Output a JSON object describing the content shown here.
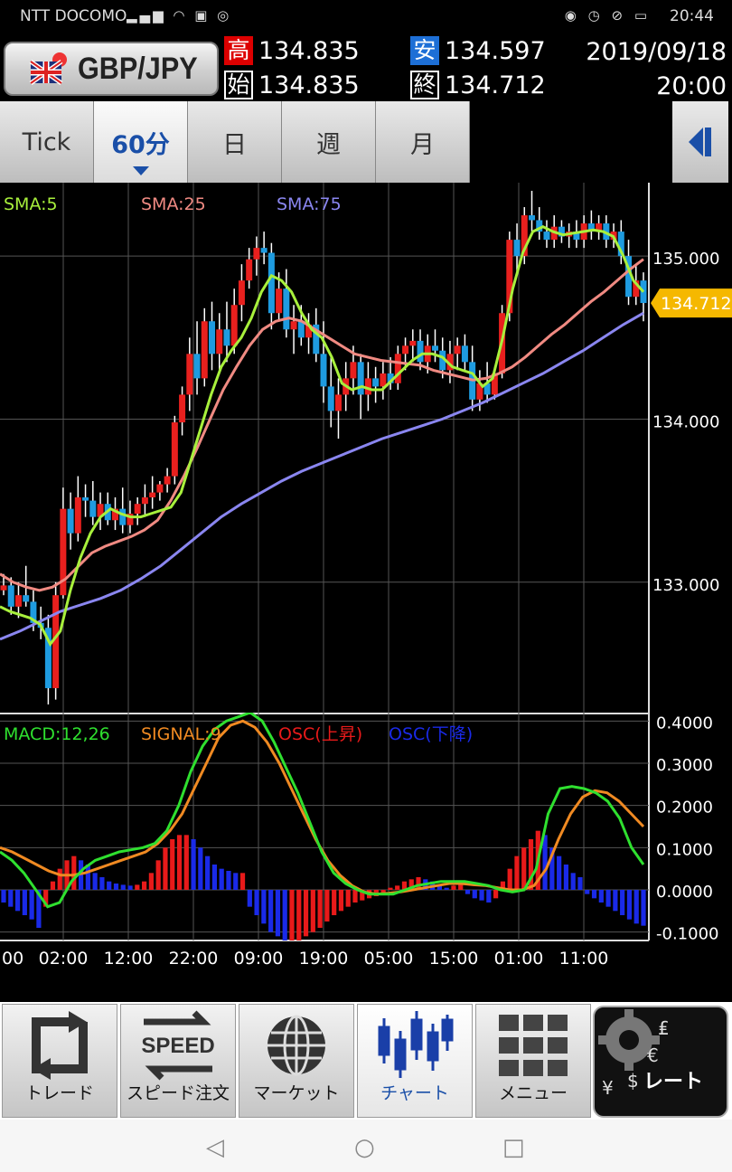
{
  "status_bar": {
    "carrier": "NTT DOCOMO",
    "time": "20:44"
  },
  "header": {
    "pair": "GBP/JPY",
    "high_label": "高",
    "high": "134.835",
    "low_label": "安",
    "low": "134.597",
    "open_label": "始",
    "open": "134.835",
    "close_label": "終",
    "close": "134.712",
    "date": "2019/09/18",
    "time": "20:00"
  },
  "tabs": [
    {
      "label": "Tick",
      "active": false
    },
    {
      "label": "60分",
      "active": true
    },
    {
      "label": "日",
      "active": false
    },
    {
      "label": "週",
      "active": false
    },
    {
      "label": "月",
      "active": false
    }
  ],
  "chart_data": [
    {
      "type": "candlestick",
      "legend": [
        "SMA:5",
        "SMA:25",
        "SMA:75"
      ],
      "colors": {
        "sma5": "#a8f03c",
        "sma25": "#f08a82",
        "sma75": "#8a86f0",
        "up": "#e8201e",
        "down": "#1e9be0",
        "wick": "#ffffff",
        "grid": "#555555",
        "price_tag": "#f5b800"
      },
      "ylim": [
        132.2,
        135.45
      ],
      "y_ticks": [
        "135.000",
        "134.000",
        "133.000"
      ],
      "current_price": "134.712",
      "candles": [
        [
          132.95,
          133.05,
          132.92,
          132.98
        ],
        [
          132.98,
          133.03,
          132.8,
          132.85
        ],
        [
          132.85,
          133.0,
          132.78,
          132.92
        ],
        [
          132.92,
          133.1,
          132.85,
          132.88
        ],
        [
          132.88,
          132.95,
          132.7,
          132.75
        ],
        [
          132.75,
          132.85,
          132.65,
          132.72
        ],
        [
          132.72,
          132.8,
          132.25,
          132.35
        ],
        [
          132.35,
          133.0,
          132.28,
          132.92
        ],
        [
          132.92,
          133.58,
          132.9,
          133.45
        ],
        [
          133.45,
          133.55,
          133.2,
          133.3
        ],
        [
          133.3,
          133.65,
          133.25,
          133.52
        ],
        [
          133.52,
          133.6,
          133.4,
          133.5
        ],
        [
          133.5,
          133.62,
          133.35,
          133.4
        ],
        [
          133.4,
          133.55,
          133.32,
          133.48
        ],
        [
          133.48,
          133.55,
          133.35,
          133.38
        ],
        [
          133.38,
          133.52,
          133.32,
          133.45
        ],
        [
          133.45,
          133.58,
          133.3,
          133.35
        ],
        [
          133.35,
          133.5,
          133.3,
          133.42
        ],
        [
          133.42,
          133.52,
          133.35,
          133.48
        ],
        [
          133.48,
          133.6,
          133.4,
          133.52
        ],
        [
          133.52,
          133.65,
          133.45,
          133.55
        ],
        [
          133.55,
          133.62,
          133.5,
          133.6
        ],
        [
          133.6,
          133.7,
          133.55,
          133.65
        ],
        [
          133.65,
          134.02,
          133.6,
          133.98
        ],
        [
          133.98,
          134.2,
          133.9,
          134.15
        ],
        [
          134.15,
          134.5,
          134.05,
          134.4
        ],
        [
          134.4,
          134.6,
          134.15,
          134.25
        ],
        [
          134.25,
          134.68,
          134.2,
          134.6
        ],
        [
          134.6,
          134.72,
          134.3,
          134.4
        ],
        [
          134.4,
          134.65,
          134.3,
          134.55
        ],
        [
          134.55,
          134.72,
          134.35,
          134.45
        ],
        [
          134.45,
          134.8,
          134.4,
          134.7
        ],
        [
          134.7,
          134.95,
          134.6,
          134.85
        ],
        [
          134.85,
          135.05,
          134.8,
          134.98
        ],
        [
          134.98,
          135.12,
          134.88,
          135.05
        ],
        [
          135.05,
          135.15,
          134.95,
          135.02
        ],
        [
          135.02,
          135.08,
          134.55,
          134.65
        ],
        [
          134.65,
          134.9,
          134.6,
          134.8
        ],
        [
          134.8,
          134.92,
          134.5,
          134.55
        ],
        [
          134.55,
          134.7,
          134.4,
          134.6
        ],
        [
          134.6,
          134.7,
          134.45,
          134.5
        ],
        [
          134.5,
          134.65,
          134.4,
          134.58
        ],
        [
          134.58,
          134.68,
          134.35,
          134.4
        ],
        [
          134.4,
          134.6,
          134.1,
          134.2
        ],
        [
          134.2,
          134.4,
          133.95,
          134.05
        ],
        [
          134.05,
          134.25,
          133.88,
          134.15
        ],
        [
          134.15,
          134.35,
          134.05,
          134.25
        ],
        [
          134.25,
          134.45,
          134.15,
          134.35
        ],
        [
          134.35,
          134.4,
          134.0,
          134.15
        ],
        [
          134.15,
          134.35,
          134.05,
          134.25
        ],
        [
          134.25,
          134.32,
          134.1,
          134.2
        ],
        [
          134.2,
          134.35,
          134.12,
          134.28
        ],
        [
          134.28,
          134.38,
          134.18,
          134.22
        ],
        [
          134.22,
          134.45,
          134.18,
          134.4
        ],
        [
          134.4,
          134.5,
          134.3,
          134.45
        ],
        [
          134.45,
          134.55,
          134.35,
          134.48
        ],
        [
          134.48,
          134.55,
          134.3,
          134.35
        ],
        [
          134.35,
          134.52,
          134.28,
          134.45
        ],
        [
          134.45,
          134.55,
          134.35,
          134.42
        ],
        [
          134.42,
          134.5,
          134.25,
          134.3
        ],
        [
          134.3,
          134.48,
          134.22,
          134.4
        ],
        [
          134.4,
          134.5,
          134.3,
          134.45
        ],
        [
          134.45,
          134.52,
          134.3,
          134.35
        ],
        [
          134.35,
          134.45,
          134.05,
          134.12
        ],
        [
          134.12,
          134.3,
          134.05,
          134.22
        ],
        [
          134.22,
          134.35,
          134.1,
          134.15
        ],
        [
          134.15,
          134.32,
          134.12,
          134.28
        ],
        [
          134.28,
          134.7,
          134.25,
          134.65
        ],
        [
          134.65,
          135.15,
          134.6,
          135.1
        ],
        [
          135.1,
          135.2,
          134.9,
          135.0
        ],
        [
          135.0,
          135.3,
          134.95,
          135.25
        ],
        [
          135.25,
          135.4,
          135.15,
          135.22
        ],
        [
          135.22,
          135.3,
          135.1,
          135.15
        ],
        [
          135.15,
          135.22,
          135.05,
          135.1
        ],
        [
          135.1,
          135.25,
          135.05,
          135.18
        ],
        [
          135.18,
          135.22,
          135.08,
          135.12
        ],
        [
          135.12,
          135.2,
          135.05,
          135.15
        ],
        [
          135.15,
          135.22,
          135.05,
          135.1
        ],
        [
          135.1,
          135.25,
          135.05,
          135.2
        ],
        [
          135.2,
          135.28,
          135.1,
          135.15
        ],
        [
          135.15,
          135.25,
          135.1,
          135.2
        ],
        [
          135.2,
          135.25,
          135.05,
          135.1
        ],
        [
          135.1,
          135.2,
          135.05,
          135.15
        ],
        [
          135.15,
          135.22,
          134.95,
          135.0
        ],
        [
          135.0,
          135.1,
          134.7,
          134.75
        ],
        [
          134.75,
          134.95,
          134.7,
          134.85
        ],
        [
          134.85,
          134.9,
          134.6,
          134.712
        ]
      ],
      "sma5": [
        132.85,
        132.82,
        132.8,
        132.78,
        132.74,
        132.62,
        132.7,
        132.95,
        133.15,
        133.3,
        133.4,
        133.45,
        133.42,
        133.4,
        133.4,
        133.42,
        133.44,
        133.46,
        133.55,
        133.75,
        133.95,
        134.15,
        134.32,
        134.42,
        134.5,
        134.62,
        134.78,
        134.88,
        134.85,
        134.78,
        134.65,
        134.55,
        134.5,
        134.38,
        134.22,
        134.18,
        134.2,
        134.18,
        134.18,
        134.24,
        134.3,
        134.36,
        134.4,
        134.4,
        134.38,
        134.32,
        134.3,
        134.28,
        134.2,
        134.25,
        134.5,
        134.8,
        135.02,
        135.15,
        135.18,
        135.15,
        135.13,
        135.14,
        135.15,
        135.16,
        135.15,
        135.12,
        135.0,
        134.85,
        134.78
      ],
      "sma25": [
        133.05,
        133.0,
        132.97,
        132.95,
        132.97,
        133.02,
        133.1,
        133.18,
        133.22,
        133.25,
        133.28,
        133.32,
        133.38,
        133.5,
        133.65,
        133.82,
        134.0,
        134.18,
        134.32,
        134.45,
        134.55,
        134.6,
        134.62,
        134.6,
        134.55,
        134.5,
        134.45,
        134.4,
        134.38,
        134.36,
        134.35,
        134.34,
        134.33,
        134.3,
        134.28,
        134.26,
        134.24,
        134.25,
        134.28,
        134.32,
        134.38,
        134.45,
        134.52,
        134.58,
        134.65,
        134.72,
        134.78,
        134.85,
        134.92,
        134.98
      ],
      "sma75": [
        132.65,
        132.7,
        132.76,
        132.82,
        132.86,
        132.9,
        132.95,
        133.02,
        133.1,
        133.2,
        133.3,
        133.4,
        133.48,
        133.55,
        133.62,
        133.68,
        133.73,
        133.78,
        133.83,
        133.88,
        133.92,
        133.96,
        134.0,
        134.05,
        134.1,
        134.16,
        134.22,
        134.28,
        134.35,
        134.42,
        134.5,
        134.58,
        134.65
      ]
    },
    {
      "type": "macd",
      "legend": [
        "MACD:12,26",
        "SIGNAL:9",
        "OSC(上昇)",
        "OSC(下降)"
      ],
      "colors": {
        "macd": "#2fe02f",
        "signal": "#f08a22",
        "osc_up": "#e81a1a",
        "osc_down": "#1a2ae8",
        "grid": "#555555"
      },
      "ylim": [
        -0.12,
        0.42
      ],
      "y_ticks": [
        "0.4000",
        "0.3000",
        "0.2000",
        "0.1000",
        "0.0000",
        "-0.1000"
      ],
      "x_ticks": [
        "00",
        "02:00",
        "12:00",
        "22:00",
        "09:00",
        "19:00",
        "05:00",
        "15:00",
        "01:00",
        "11:00"
      ],
      "osc": [
        -0.03,
        -0.04,
        -0.05,
        -0.06,
        -0.07,
        -0.09,
        -0.04,
        0.02,
        0.05,
        0.07,
        0.08,
        0.07,
        0.06,
        0.04,
        0.03,
        0.02,
        0.015,
        0.012,
        0.01,
        0.012,
        0.02,
        0.04,
        0.07,
        0.1,
        0.12,
        0.13,
        0.13,
        0.12,
        0.1,
        0.08,
        0.06,
        0.05,
        0.045,
        0.04,
        0.04,
        -0.04,
        -0.06,
        -0.08,
        -0.1,
        -0.11,
        -0.12,
        -0.12,
        -0.12,
        -0.11,
        -0.1,
        -0.09,
        -0.075,
        -0.06,
        -0.05,
        -0.04,
        -0.03,
        -0.025,
        -0.02,
        -0.015,
        -0.01,
        0.005,
        0.01,
        0.02,
        0.025,
        0.03,
        0.025,
        0.02,
        0.01,
        0.005,
        0.01,
        0.012,
        -0.01,
        -0.02,
        -0.025,
        -0.03,
        -0.02,
        0.02,
        0.05,
        0.08,
        0.1,
        0.12,
        0.14,
        0.13,
        0.1,
        0.08,
        0.06,
        0.04,
        0.03,
        -0.01,
        -0.02,
        -0.03,
        -0.04,
        -0.05,
        -0.06,
        -0.07,
        -0.08,
        -0.085
      ],
      "macd": [
        0.09,
        0.07,
        0.04,
        0.0,
        -0.04,
        -0.03,
        0.02,
        0.05,
        0.07,
        0.08,
        0.09,
        0.095,
        0.1,
        0.11,
        0.14,
        0.2,
        0.28,
        0.34,
        0.38,
        0.4,
        0.41,
        0.42,
        0.4,
        0.35,
        0.29,
        0.23,
        0.16,
        0.09,
        0.04,
        0.015,
        0.0,
        -0.01,
        -0.01,
        -0.01,
        0.0,
        0.01,
        0.015,
        0.02,
        0.02,
        0.02,
        0.015,
        0.01,
        0.0,
        -0.005,
        0.0,
        0.05,
        0.18,
        0.24,
        0.245,
        0.24,
        0.23,
        0.21,
        0.17,
        0.1,
        0.06
      ],
      "signal": [
        0.1,
        0.09,
        0.075,
        0.06,
        0.045,
        0.035,
        0.035,
        0.04,
        0.05,
        0.06,
        0.07,
        0.08,
        0.09,
        0.11,
        0.14,
        0.18,
        0.24,
        0.3,
        0.36,
        0.39,
        0.4,
        0.385,
        0.35,
        0.3,
        0.24,
        0.18,
        0.12,
        0.07,
        0.035,
        0.01,
        -0.005,
        -0.01,
        -0.008,
        -0.005,
        0.0,
        0.005,
        0.01,
        0.015,
        0.015,
        0.012,
        0.01,
        0.005,
        0.0,
        0.0,
        0.01,
        0.05,
        0.12,
        0.18,
        0.22,
        0.235,
        0.23,
        0.21,
        0.18,
        0.15
      ]
    }
  ],
  "nav": [
    {
      "label": "トレード",
      "icon": "trade-arrows-icon",
      "active": false
    },
    {
      "label": "スピード注文",
      "icon": "speed-icon",
      "icon_text": "SPEED",
      "active": false
    },
    {
      "label": "マーケット",
      "icon": "globe-icon",
      "active": false
    },
    {
      "label": "チャート",
      "icon": "chart-candles-icon",
      "active": true
    },
    {
      "label": "メニュー",
      "icon": "grid-menu-icon",
      "active": false
    }
  ],
  "rate_button": {
    "label": "レート",
    "icon": "currency-gears-icon"
  }
}
